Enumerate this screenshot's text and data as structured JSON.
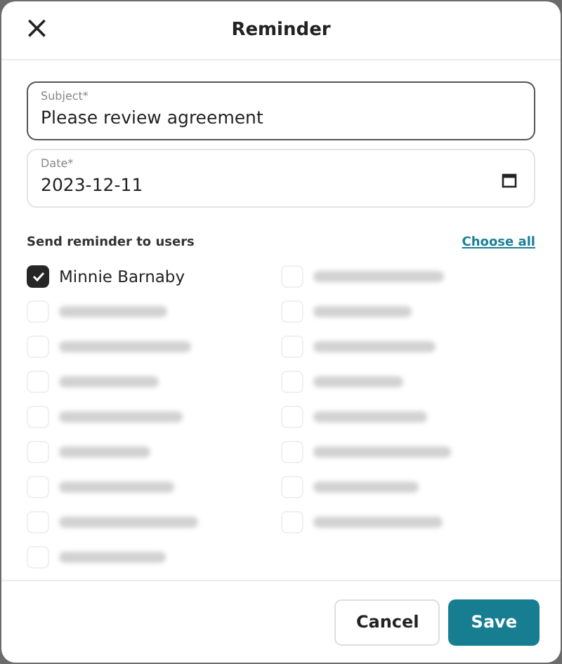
{
  "dialog": {
    "title": "Reminder",
    "close": "×"
  },
  "subject": {
    "label": "Subject*",
    "value": "Please review agreement",
    "focused": true
  },
  "date": {
    "label": "Date*",
    "value": "2023-12-11"
  },
  "users": {
    "heading": "Send reminder to users",
    "choose_all": "Choose all",
    "columns": [
      [
        {
          "name": "Minnie Barnaby",
          "checked": true
        },
        {
          "blurred": true,
          "checked": false
        },
        {
          "blurred": true,
          "checked": false
        },
        {
          "blurred": true,
          "checked": false
        },
        {
          "blurred": true,
          "checked": false
        },
        {
          "blurred": true,
          "checked": false
        },
        {
          "blurred": true,
          "checked": false
        },
        {
          "blurred": true,
          "checked": false
        },
        {
          "blurred": true,
          "checked": false
        }
      ],
      [
        {
          "blurred": true,
          "checked": false
        },
        {
          "blurred": true,
          "checked": false
        },
        {
          "blurred": true,
          "checked": false
        },
        {
          "blurred": true,
          "checked": false
        },
        {
          "blurred": true,
          "checked": false
        },
        {
          "blurred": true,
          "checked": false
        },
        {
          "blurred": true,
          "checked": false
        },
        {
          "blurred": true,
          "checked": false
        }
      ]
    ]
  },
  "buttons": [
    {
      "label": "Cancel",
      "kind": "secondary"
    },
    {
      "label": "Save",
      "kind": "primary"
    }
  ]
}
